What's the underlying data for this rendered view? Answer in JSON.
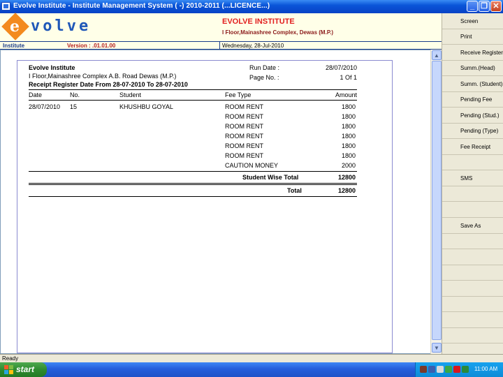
{
  "window": {
    "title": "Evolve Institute - Institute Management System ( -) 2010-2011 (...LICENCE...)",
    "minimize": "_",
    "restore": "❐",
    "close": "✕"
  },
  "header": {
    "logo_e": "e",
    "logo_text": "volve",
    "institute_name": "EVOLVE INSTITUTE",
    "institute_address": "I Floor,Mainashree Complex, Dewas (M.P.)"
  },
  "infobar": {
    "institute": "Institute",
    "version": "Version : .01.01.00",
    "date": "Wednesday, 28-Jul-2010"
  },
  "report": {
    "org_name": "Evolve Institute",
    "org_address": "I Floor,Mainashree Complex A.B. Road Dewas (M.P.)",
    "title": "Receipt Register Date From 28-07-2010 To 28-07-2010",
    "run_date_label": "Run Date :",
    "run_date": "28/07/2010",
    "page_label": "Page No. :",
    "page_value": "1 Of 1",
    "columns": {
      "date": "Date",
      "no": "No.",
      "student": "Student",
      "fee_type": "Fee Type",
      "amount": "Amount"
    },
    "row": {
      "date": "28/07/2010",
      "no": "15",
      "student": "KHUSHBU  GOYAL"
    },
    "lines": [
      {
        "fee_type": "ROOM RENT",
        "amount": "1800"
      },
      {
        "fee_type": "ROOM RENT",
        "amount": "1800"
      },
      {
        "fee_type": "ROOM RENT",
        "amount": "1800"
      },
      {
        "fee_type": "ROOM RENT",
        "amount": "1800"
      },
      {
        "fee_type": "ROOM RENT",
        "amount": "1800"
      },
      {
        "fee_type": "ROOM RENT",
        "amount": "1800"
      },
      {
        "fee_type": "CAUTION MONEY",
        "amount": "2000"
      }
    ],
    "student_total_label": "Student Wise Total",
    "student_total": "12800",
    "total_label": "Total",
    "total": "12800"
  },
  "scrollbar": {
    "up": "▲",
    "down": "▼"
  },
  "side_buttons": [
    "Screen",
    "Print",
    "Receive Register",
    "Summ.(Head)",
    "Summ. (Student)",
    "Pending Fee",
    "Pending (Stud.)",
    "Pending (Type)",
    "Fee Receipt",
    "",
    "SMS",
    "",
    "Save As",
    "",
    "",
    "",
    "",
    "",
    "",
    "",
    ""
  ],
  "status": {
    "text": "Ready"
  },
  "taskbar": {
    "start": "start",
    "clock": "11:00 AM"
  }
}
